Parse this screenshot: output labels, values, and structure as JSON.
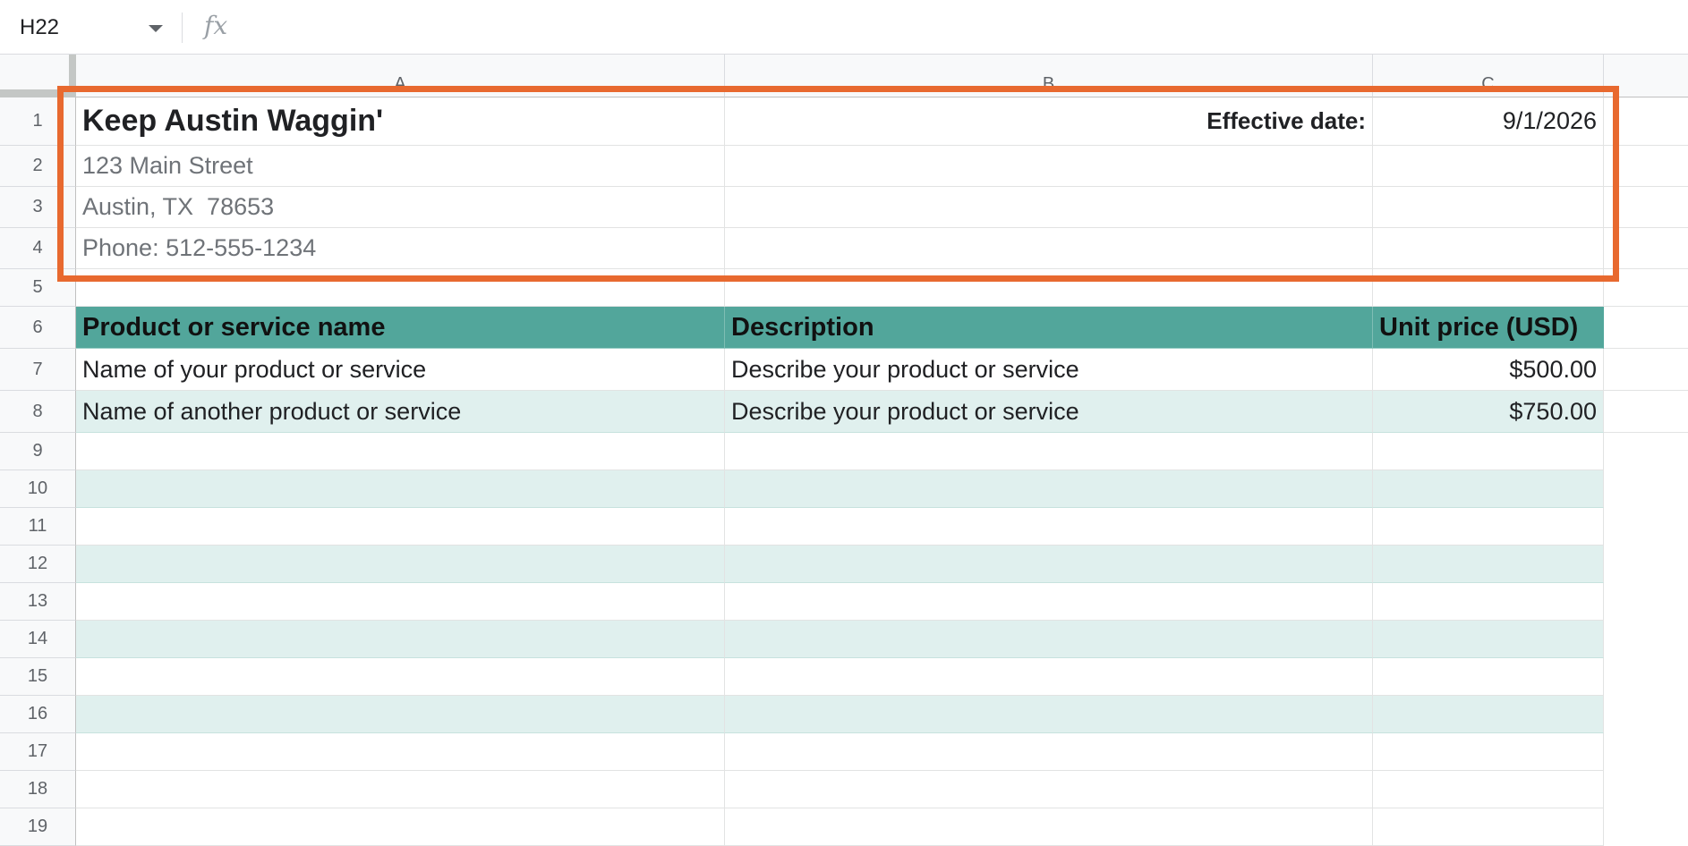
{
  "formula_bar": {
    "name_box": "H22",
    "fx_label": "fx",
    "formula_value": ""
  },
  "columns": [
    "A",
    "B",
    "C"
  ],
  "rows": [
    "1",
    "2",
    "3",
    "4",
    "5",
    "6",
    "7",
    "8",
    "9",
    "10",
    "11",
    "12",
    "13",
    "14",
    "15",
    "16",
    "17",
    "18",
    "19"
  ],
  "sheet": {
    "company_name": "Keep Austin Waggin'",
    "address_line1": "123 Main Street",
    "address_line2": "Austin, TX  78653",
    "phone": "Phone: 512-555-1234",
    "effective_date_label": "Effective date:",
    "effective_date_value": "9/1/2026",
    "table_headers": [
      "Product or service name",
      "Description",
      "Unit price (USD)"
    ],
    "table_rows": [
      [
        "Name of your product or service",
        "Describe your product or service",
        "$500.00"
      ],
      [
        "Name of another product or service",
        "Describe your product or service",
        "$750.00"
      ]
    ]
  },
  "colors": {
    "header_band": "#52a69b",
    "alt_band": "#e0f0ee",
    "highlight_border": "#e8692f"
  },
  "icons": [
    "dropdown-arrow-icon",
    "fx-icon"
  ]
}
